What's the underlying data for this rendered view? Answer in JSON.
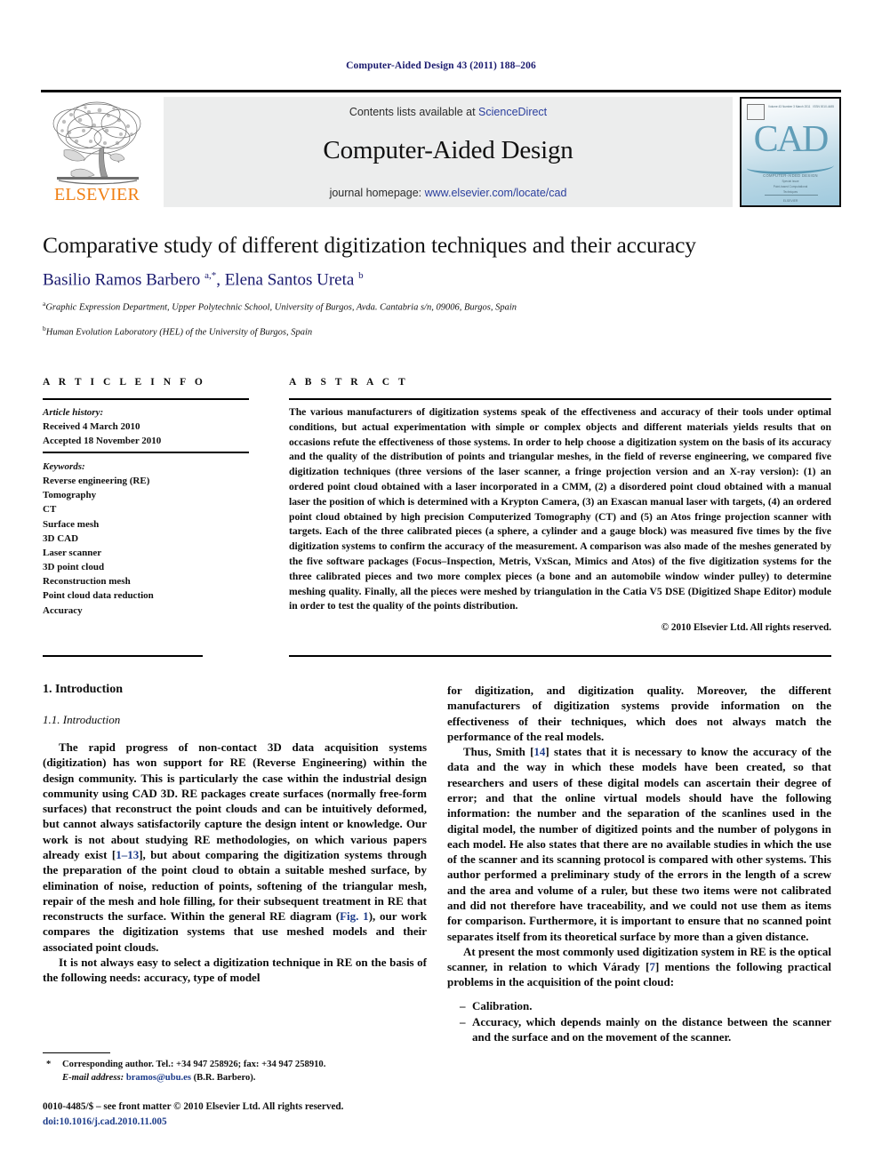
{
  "running_head": "Computer-Aided Design 43 (2011) 188–206",
  "masthead": {
    "contents_prefix": "Contents lists available at ",
    "contents_link": "ScienceDirect",
    "journal_title": "Computer-Aided Design",
    "homepage_prefix": "journal homepage: ",
    "homepage_url": "www.elsevier.com/locate/cad",
    "publisher_wordmark": "ELSEVIER",
    "cover": {
      "letters": "CAD",
      "line1": "COMPUTER-AIDED DESIGN",
      "line2": "Special Issue",
      "line3": "Point-based Computational",
      "line4": "Techniques",
      "line5": "ELSEVIER",
      "hdr_left": "Volume 43  Number 3  March 2011",
      "hdr_right": "ISSN 0010-4485"
    },
    "link_color": "#2b3f9e",
    "brand_color": "#F07F13"
  },
  "title": "Comparative study of different digitization techniques and their accuracy",
  "authors_html": "Basilio Ramos Barbero <sup>a,*</sup>, Elena Santos Ureta <sup>b</sup>",
  "affiliations": [
    {
      "marker": "a",
      "text": "Graphic Expression Department, Upper Polytechnic School, University of Burgos, Avda. Cantabria s/n, 09006, Burgos, Spain"
    },
    {
      "marker": "b",
      "text": "Human Evolution Laboratory (HEL) of the University of Burgos, Spain"
    }
  ],
  "article_info": {
    "heading": "A R T I C L E   I N F O",
    "history_label": "Article history:",
    "history": [
      "Received 4 March 2010",
      "Accepted 18 November 2010"
    ],
    "keywords_label": "Keywords:",
    "keywords": [
      "Reverse engineering (RE)",
      "Tomography",
      "CT",
      "Surface mesh",
      "3D CAD",
      "Laser scanner",
      "3D point cloud",
      "Reconstruction mesh",
      "Point cloud data reduction",
      "Accuracy"
    ]
  },
  "abstract": {
    "heading": "A B S T R A C T",
    "text": "The various manufacturers of digitization systems speak of the effectiveness and accuracy of their tools under optimal conditions, but actual experimentation with simple or complex objects and different materials yields results that on occasions refute the effectiveness of those systems. In order to help choose a digitization system on the basis of its accuracy and the quality of the distribution of points and triangular meshes, in the field of reverse engineering, we compared five digitization techniques (three versions of the laser scanner, a fringe projection version and an X-ray version): (1) an ordered point cloud obtained with a laser incorporated in a CMM, (2) a disordered point cloud obtained with a manual laser the position of which is determined with a Krypton Camera, (3) an Exascan manual laser with targets, (4) an ordered point cloud obtained by high precision Computerized Tomography (CT) and (5) an Atos fringe projection scanner with targets. Each of the three calibrated pieces (a sphere, a cylinder and a gauge block) was measured five times by the five digitization systems to confirm the accuracy of the measurement. A comparison was also made of the meshes generated by the five software packages (Focus–Inspection, Metris, VxScan, Mimics and Atos) of the five digitization systems for the three calibrated pieces and two more complex pieces (a bone and an automobile window winder pulley) to determine meshing quality. Finally, all the pieces were meshed by triangulation in the Catia V5 DSE (Digitized Shape Editor) module in order to test the quality of the points distribution.",
    "copyright": "© 2010 Elsevier Ltd. All rights reserved."
  },
  "body": {
    "section_number_title": "1. Introduction",
    "subsection_title": "1.1. Introduction",
    "left_p1_a": "The rapid progress of non-contact 3D data acquisition systems (digitization) has won support for RE (Reverse Engineering) within the design community. This is particularly the case within the industrial design community using CAD 3D. RE packages create surfaces (normally free-form surfaces) that reconstruct the point clouds and can be intuitively deformed, but cannot always satisfactorily capture the design intent or knowledge. Our work is not about studying RE methodologies, on which various papers already exist [",
    "left_p1_ref1": "1–13",
    "left_p1_b": "], but about comparing the digitization systems through the preparation of the point cloud to obtain a suitable meshed surface, by elimination of noise, reduction of points, softening of the triangular mesh, repair of the mesh and hole filling, for their subsequent treatment in RE that reconstructs the surface. Within the general RE diagram (",
    "left_p1_ref2": "Fig. 1",
    "left_p1_c": "), our work compares the digitization systems that use meshed models and their associated point clouds.",
    "left_p2": "It is not always easy to select a digitization technique in RE on the basis of the following needs: accuracy, type of model",
    "right_p1": "for digitization, and digitization quality. Moreover, the different manufacturers of digitization systems provide information on the effectiveness of their techniques, which does not always match the performance of the real models.",
    "right_p2_a": "Thus, Smith [",
    "right_p2_ref": "14",
    "right_p2_b": "] states that it is necessary to know the accuracy of the data and the way in which these models have been created, so that researchers and users of these digital models can ascertain their degree of error; and that the online virtual models should have the following information: the number and the separation of the scanlines used in the digital model, the number of digitized points and the number of polygons in each model. He also states that there are no available studies in which the use of the scanner and its scanning protocol is compared with other systems. This author performed a preliminary study of the errors in the length of a screw and the area and volume of a ruler, but these two items were not calibrated and did not therefore have traceability, and we could not use them as items for comparison. Furthermore, it is important to ensure that no scanned point separates itself from its theoretical surface by more than a given distance.",
    "right_p3_a": "At present the most commonly used digitization system in RE is the optical scanner, in relation to which Várady [",
    "right_p3_ref": "7",
    "right_p3_b": "] mentions the following practical problems in the acquisition of the point cloud:",
    "bullets": [
      "Calibration.",
      "Accuracy, which depends mainly on the distance between the scanner and the surface and on the movement of the scanner."
    ]
  },
  "footnote": {
    "star": "*",
    "line1": "Corresponding author. Tel.: +34 947 258926; fax: +34 947 258910.",
    "email_label": "E-mail address:",
    "email": "bramos@ubu.es",
    "email_suffix": "(B.R. Barbero)."
  },
  "footer": {
    "issn_line": "0010-4485/$ – see front matter © 2010 Elsevier Ltd. All rights reserved.",
    "doi": "doi:10.1016/j.cad.2010.11.005"
  }
}
